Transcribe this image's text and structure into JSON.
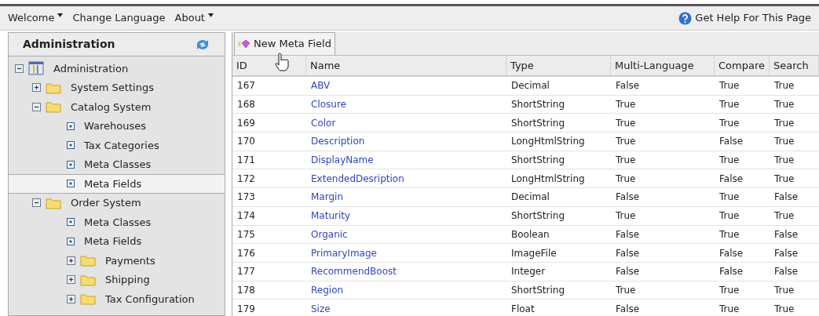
{
  "menu_bar": {
    "items": [
      {
        "label": "Welcome",
        "dropdown": true
      },
      {
        "label": "Change Language",
        "dropdown": false
      },
      {
        "label": "About",
        "dropdown": true
      }
    ],
    "help_link": "Get Help For This Page"
  },
  "sidebar": {
    "title": "Administration",
    "tree": [
      {
        "label": "Administration",
        "kind": "root",
        "expanded": true,
        "selected": false,
        "children": [
          {
            "label": "System Settings",
            "kind": "folder",
            "expanded": false,
            "selected": false
          },
          {
            "label": "Catalog System",
            "kind": "folder",
            "expanded": true,
            "selected": false,
            "children": [
              {
                "label": "Warehouses",
                "kind": "leaf",
                "selected": false
              },
              {
                "label": "Tax Categories",
                "kind": "leaf",
                "selected": false
              },
              {
                "label": "Meta Classes",
                "kind": "leaf",
                "selected": false
              },
              {
                "label": "Meta Fields",
                "kind": "leaf",
                "selected": true
              }
            ]
          },
          {
            "label": "Order System",
            "kind": "folder",
            "expanded": true,
            "selected": false,
            "children": [
              {
                "label": "Meta Classes",
                "kind": "leaf",
                "selected": false
              },
              {
                "label": "Meta Fields",
                "kind": "leaf",
                "selected": false
              },
              {
                "label": "Payments",
                "kind": "folder",
                "expanded": false,
                "selected": false
              },
              {
                "label": "Shipping",
                "kind": "folder",
                "expanded": false,
                "selected": false
              },
              {
                "label": "Tax Configuration",
                "kind": "folder",
                "expanded": false,
                "selected": false
              }
            ]
          }
        ]
      }
    ]
  },
  "toolbar": {
    "button": "New Meta Field"
  },
  "table": {
    "columns": [
      "ID",
      "Name",
      "Type",
      "Multi-Language",
      "Compare",
      "Search"
    ],
    "rows": [
      [
        "167",
        "ABV",
        "Decimal",
        "False",
        "True",
        "True"
      ],
      [
        "168",
        "Closure",
        "ShortString",
        "True",
        "True",
        "True"
      ],
      [
        "169",
        "Color",
        "ShortString",
        "True",
        "True",
        "True"
      ],
      [
        "170",
        "Description",
        "LongHtmlString",
        "True",
        "False",
        "True"
      ],
      [
        "171",
        "DisplayName",
        "ShortString",
        "True",
        "True",
        "True"
      ],
      [
        "172",
        "ExtendedDesription",
        "LongHtmlString",
        "True",
        "False",
        "True"
      ],
      [
        "173",
        "Margin",
        "Decimal",
        "False",
        "True",
        "False"
      ],
      [
        "174",
        "Maturity",
        "ShortString",
        "True",
        "True",
        "True"
      ],
      [
        "175",
        "Organic",
        "Boolean",
        "False",
        "True",
        "False"
      ],
      [
        "176",
        "PrimaryImage",
        "ImageFile",
        "False",
        "False",
        "False"
      ],
      [
        "177",
        "RecommendBoost",
        "Integer",
        "False",
        "False",
        "False"
      ],
      [
        "178",
        "Region",
        "ShortString",
        "True",
        "True",
        "True"
      ],
      [
        "179",
        "Size",
        "Float",
        "False",
        "True",
        "True"
      ]
    ]
  }
}
